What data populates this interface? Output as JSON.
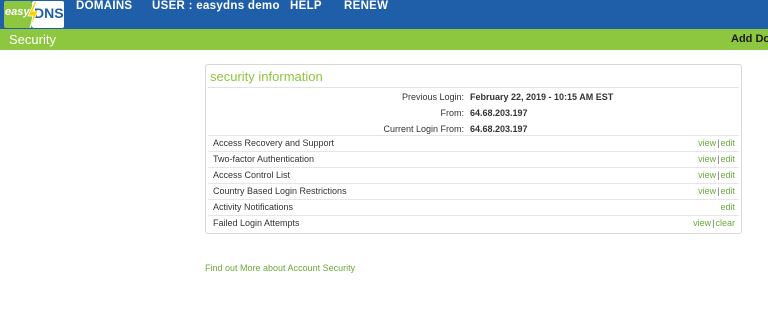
{
  "header": {
    "logo": {
      "easy": "easy",
      "dns": "DNS"
    },
    "nav": [
      "DOMAINS",
      "USER : easydns demo",
      "HELP",
      "RENEW"
    ]
  },
  "subheader": {
    "title": "Security",
    "add_link": "Add Dom"
  },
  "panel": {
    "heading": "security information",
    "info": [
      {
        "label": "Previous Login:",
        "value": "February 22, 2019 - 10:15 AM EST"
      },
      {
        "label": "From:",
        "value": "64.68.203.197"
      },
      {
        "label": "Current Login From:",
        "value": "64.68.203.197"
      }
    ],
    "rows": [
      {
        "label": "Access Recovery and Support",
        "actions": [
          "view",
          "edit"
        ]
      },
      {
        "label": "Two-factor Authentication",
        "actions": [
          "view",
          "edit"
        ]
      },
      {
        "label": "Access Control List",
        "actions": [
          "view",
          "edit"
        ]
      },
      {
        "label": "Country Based Login Restrictions",
        "actions": [
          "view",
          "edit"
        ]
      },
      {
        "label": "Activity Notifications",
        "actions": [
          "edit"
        ]
      },
      {
        "label": "Failed Login Attempts",
        "actions": [
          "view",
          "clear"
        ]
      }
    ]
  },
  "footer_link": "Find out More about Account Security",
  "colors": {
    "nav_bg": "#1f5ea8",
    "accent_green": "#8dc63f",
    "link_green": "#6aa93a"
  }
}
